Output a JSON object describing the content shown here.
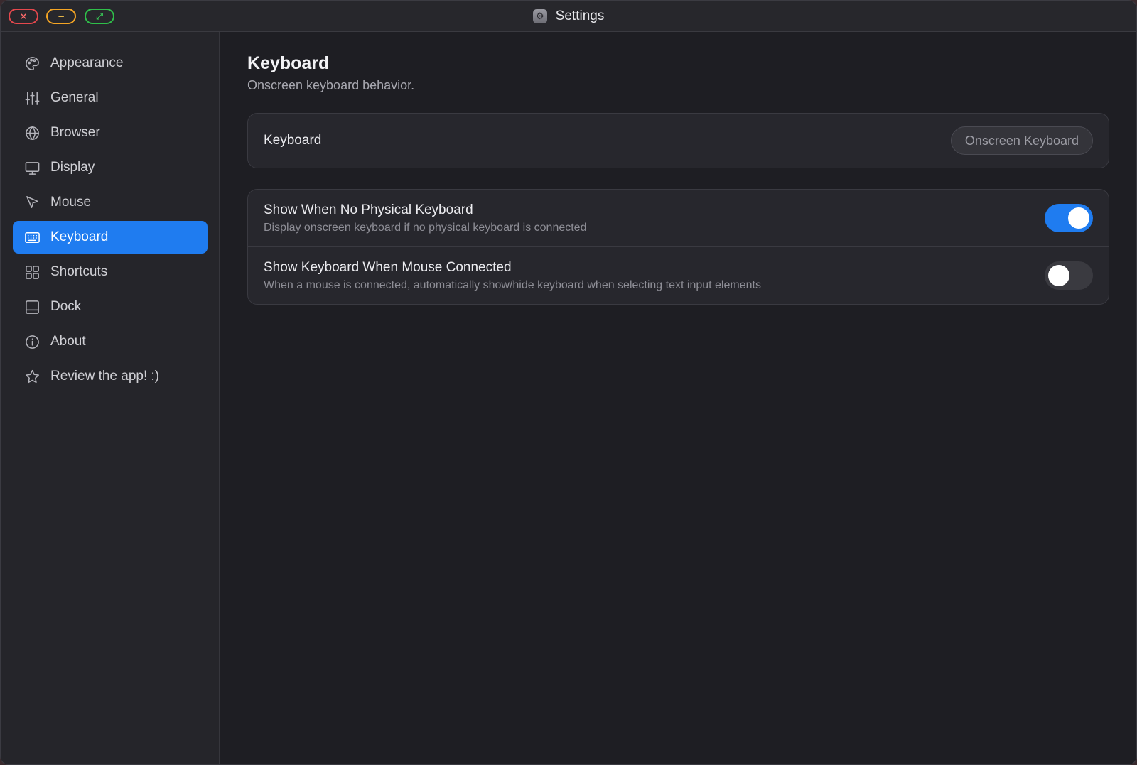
{
  "window": {
    "title": "Settings",
    "title_icon": "gear-icon",
    "traffic": {
      "close_glyph": "×",
      "minimize_glyph": "−",
      "maximize_glyph": "⤢"
    }
  },
  "sidebar": {
    "items": [
      {
        "label": "Appearance",
        "icon": "palette-icon",
        "active": false
      },
      {
        "label": "General",
        "icon": "sliders-icon",
        "active": false
      },
      {
        "label": "Browser",
        "icon": "globe-icon",
        "active": false
      },
      {
        "label": "Display",
        "icon": "monitor-icon",
        "active": false
      },
      {
        "label": "Mouse",
        "icon": "cursor-icon",
        "active": false
      },
      {
        "label": "Keyboard",
        "icon": "keyboard-icon",
        "active": true
      },
      {
        "label": "Shortcuts",
        "icon": "grid-icon",
        "active": false
      },
      {
        "label": "Dock",
        "icon": "dock-icon",
        "active": false
      },
      {
        "label": "About",
        "icon": "info-icon",
        "active": false
      },
      {
        "label": "Review the app! :)",
        "icon": "star-icon",
        "active": false
      }
    ]
  },
  "main": {
    "title": "Keyboard",
    "subtitle": "Onscreen keyboard behavior.",
    "keyboard_card": {
      "label": "Keyboard",
      "button_label": "Onscreen Keyboard"
    },
    "settings": [
      {
        "title": "Show When No Physical Keyboard",
        "description": "Display onscreen keyboard if no physical keyboard is connected",
        "enabled": true
      },
      {
        "title": "Show Keyboard When Mouse Connected",
        "description": "When a mouse is connected, automatically show/hide keyboard when selecting text input elements",
        "enabled": false
      }
    ]
  },
  "colors": {
    "accent": "#1f7cf0",
    "background": "#1e1e23",
    "sidebar": "#25252a",
    "card": "#27272d"
  }
}
